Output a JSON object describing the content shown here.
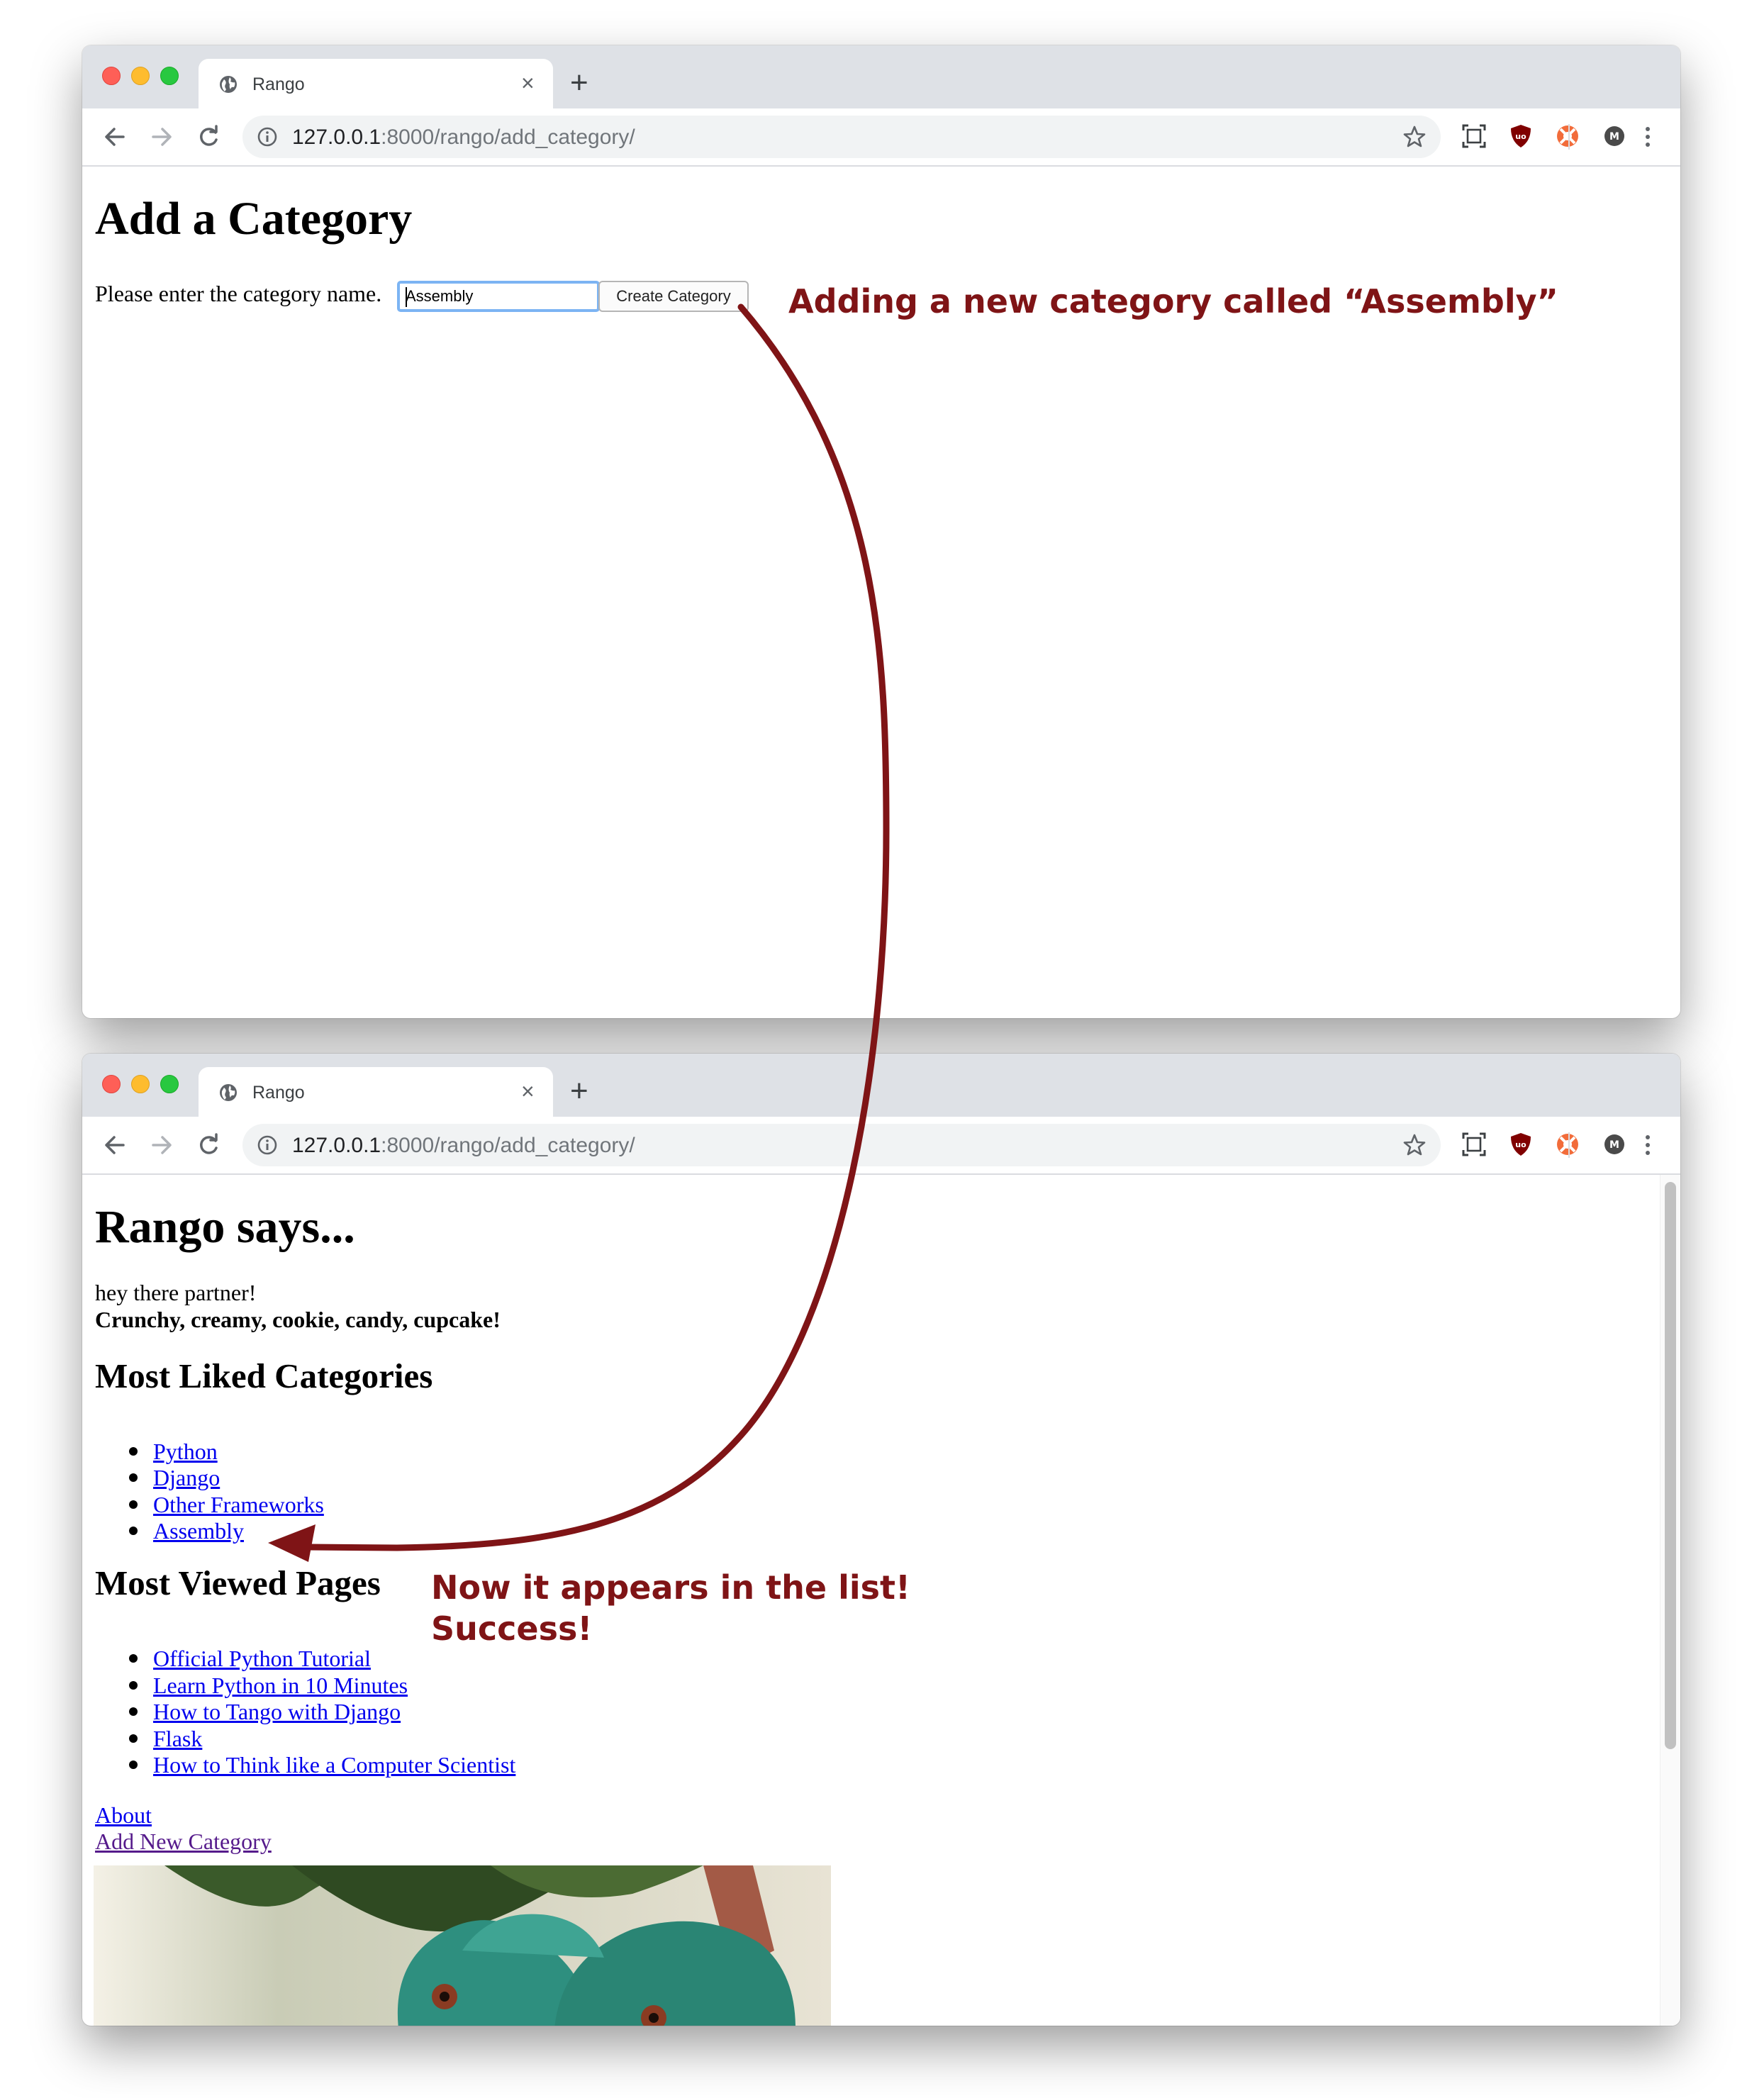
{
  "browser": {
    "tab_title": "Rango",
    "url_host": "127.0.0.1",
    "url_rest": ":8000/rango/add_category/"
  },
  "add_page": {
    "heading": "Add a Category",
    "prompt": "Please enter the category name.",
    "input_value": "Assembly",
    "submit_label": "Create Category"
  },
  "index_page": {
    "heading": "Rango says...",
    "greeting": "hey there partner!",
    "boldline": "Crunchy, creamy, cookie, candy, cupcake!",
    "liked_heading": "Most Liked Categories",
    "liked": [
      "Python",
      "Django",
      "Other Frameworks",
      "Assembly"
    ],
    "viewed_heading": "Most Viewed Pages",
    "viewed": [
      "Official Python Tutorial",
      "Learn Python in 10 Minutes",
      "How to Tango with Django",
      "Flask",
      "How to Think like a Computer Scientist"
    ],
    "about_link": "About",
    "add_link": "Add New Category"
  },
  "annotations": {
    "top": "Adding a new category called “Assembly”",
    "bottom_line1": "Now it appears in the list!",
    "bottom_line2": "Success!",
    "color": "#7f1416"
  }
}
